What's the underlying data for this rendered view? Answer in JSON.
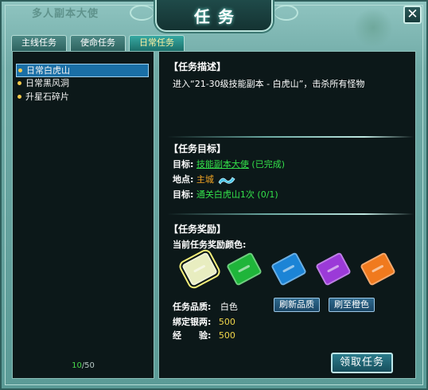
{
  "window": {
    "title": "任务",
    "background_label": "多人副本大使",
    "close_symbol": "✕"
  },
  "tabs": [
    {
      "label": "主线任务",
      "active": false
    },
    {
      "label": "使命任务",
      "active": false
    },
    {
      "label": "日常任务",
      "active": true
    }
  ],
  "quest_list": {
    "items": [
      {
        "label": "日常白虎山",
        "selected": true
      },
      {
        "label": "日常黑风洞",
        "selected": false
      },
      {
        "label": "升星石碎片",
        "selected": false
      }
    ],
    "count_current": "10",
    "count_sep_total": "/50"
  },
  "description": {
    "title": "【任务描述】",
    "text": "进入“21-30级技能副本 - 白虎山”，击杀所有怪物"
  },
  "objectives": {
    "title": "【任务目标】",
    "npc_label": "目标:",
    "npc_name": "技能副本大使",
    "npc_status": "(已完成)",
    "location_label": "地点:",
    "location_value": "主城",
    "goal_label": "目标:",
    "goal_value": "通关白虎山1次 (0/1)"
  },
  "rewards": {
    "title": "【任务奖励】",
    "color_label": "当前任务奖励颜色:",
    "cards": [
      {
        "color": "#e8edc0",
        "selected": true
      },
      {
        "color": "#1fb53a",
        "selected": false
      },
      {
        "color": "#1c84d6",
        "selected": false
      },
      {
        "color": "#9b3ad8",
        "selected": false
      },
      {
        "color": "#f07a1e",
        "selected": false
      }
    ],
    "quality_label": "任务品质:",
    "quality_value": "白色",
    "refresh_button": "刷新品质",
    "orange_button": "刷至橙色",
    "silver_label": "绑定银两:",
    "silver_value": "500",
    "exp_label": "经　　验:",
    "exp_value": "500"
  },
  "claim_button": "领取任务",
  "colors": {
    "frame": "#6ea9a5",
    "panel": "#0c1819",
    "selected_row": "#1a6fa6",
    "green_text": "#33e04a",
    "yellow_text": "#f0d64a"
  }
}
